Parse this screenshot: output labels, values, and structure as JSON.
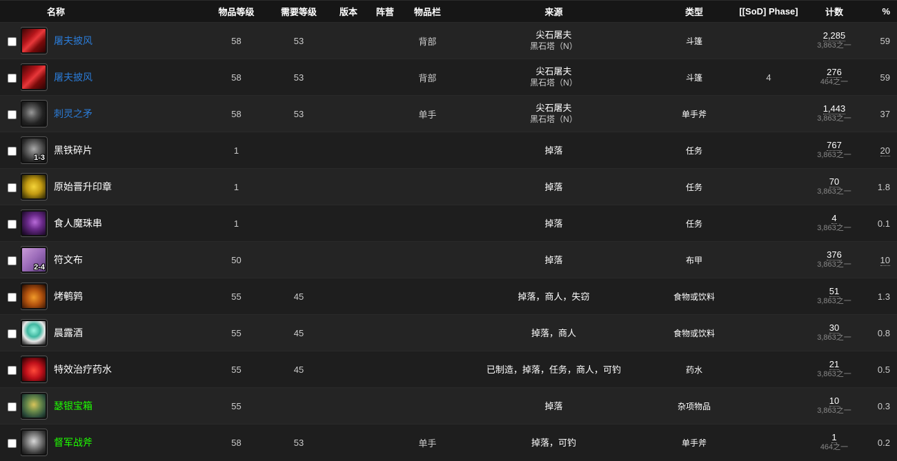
{
  "headers": {
    "name": "名称",
    "item_level": "物品等级",
    "req_level": "需要等级",
    "version": "版本",
    "faction": "阵营",
    "slot": "物品栏",
    "source": "来源",
    "type": "类型",
    "phase": "[[SoD] Phase]",
    "count": "计数",
    "percent": "%"
  },
  "rows": [
    {
      "icon": "cape-icon",
      "icon_class": "ic-cape",
      "qty": "",
      "name": "屠夫披风",
      "quality": "q-blue",
      "ilvl": "58",
      "req": "53",
      "slot": "背部",
      "src1": "尖石屠夫",
      "src2": "黑石塔（N）",
      "type": "斗篷",
      "phase": "",
      "count": "2,285",
      "of": "3,863之一",
      "pct": "59",
      "pct_dotted": false
    },
    {
      "icon": "cape-icon",
      "icon_class": "ic-cape",
      "qty": "",
      "name": "屠夫披风",
      "quality": "q-blue",
      "ilvl": "58",
      "req": "53",
      "slot": "背部",
      "src1": "尖石屠夫",
      "src2": "黑石塔（N）",
      "type": "斗篷",
      "phase": "4",
      "count": "276",
      "of": "464之一",
      "pct": "59",
      "pct_dotted": false
    },
    {
      "icon": "axe-icon",
      "icon_class": "ic-axe",
      "qty": "",
      "name": "刺灵之矛",
      "quality": "q-blue",
      "ilvl": "58",
      "req": "53",
      "slot": "单手",
      "src1": "尖石屠夫",
      "src2": "黑石塔（N）",
      "type": "单手斧",
      "phase": "",
      "count": "1,443",
      "of": "3,863之一",
      "pct": "37",
      "pct_dotted": false
    },
    {
      "icon": "iron-shard-icon",
      "icon_class": "ic-iron",
      "qty": "1-3",
      "name": "黑铁碎片",
      "quality": "q-white",
      "ilvl": "1",
      "req": "",
      "slot": "",
      "src1": "掉落",
      "src2": "",
      "type": "任务",
      "phase": "",
      "count": "767",
      "of": "3,863之一",
      "pct": "20",
      "pct_dotted": true
    },
    {
      "icon": "seal-icon",
      "icon_class": "ic-seal",
      "qty": "",
      "name": "原始晋升印章",
      "quality": "q-white",
      "ilvl": "1",
      "req": "",
      "slot": "",
      "src1": "掉落",
      "src2": "",
      "type": "任务",
      "phase": "",
      "count": "70",
      "of": "3,863之一",
      "pct": "1.8",
      "pct_dotted": false
    },
    {
      "icon": "bead-string-icon",
      "icon_class": "ic-string",
      "qty": "",
      "name": "食人魔珠串",
      "quality": "q-white",
      "ilvl": "1",
      "req": "",
      "slot": "",
      "src1": "掉落",
      "src2": "",
      "type": "任务",
      "phase": "",
      "count": "4",
      "of": "3,863之一",
      "pct": "0.1",
      "pct_dotted": false
    },
    {
      "icon": "cloth-icon",
      "icon_class": "ic-cloth",
      "qty": "2-4",
      "name": "符文布",
      "quality": "q-white",
      "ilvl": "50",
      "req": "",
      "slot": "",
      "src1": "掉落",
      "src2": "",
      "type": "布甲",
      "phase": "",
      "count": "376",
      "of": "3,863之一",
      "pct": "10",
      "pct_dotted": true
    },
    {
      "icon": "roast-bird-icon",
      "icon_class": "ic-bird",
      "qty": "",
      "name": "烤鹌鹑",
      "quality": "q-white",
      "ilvl": "55",
      "req": "45",
      "slot": "",
      "src1": "掉落，商人，失窃",
      "src2": "",
      "type": "食物或饮料",
      "phase": "",
      "count": "51",
      "of": "3,863之一",
      "pct": "1.3",
      "pct_dotted": false
    },
    {
      "icon": "wine-icon",
      "icon_class": "ic-wine",
      "qty": "",
      "name": "晨露酒",
      "quality": "q-white",
      "ilvl": "55",
      "req": "45",
      "slot": "",
      "src1": "掉落，商人",
      "src2": "",
      "type": "食物或饮料",
      "phase": "",
      "count": "30",
      "of": "3,863之一",
      "pct": "0.8",
      "pct_dotted": false
    },
    {
      "icon": "potion-icon",
      "icon_class": "ic-potion",
      "qty": "",
      "name": "特效治疗药水",
      "quality": "q-white",
      "ilvl": "55",
      "req": "45",
      "slot": "",
      "src1": "已制造，掉落，任务，商人，可钓",
      "src2": "",
      "type": "药水",
      "phase": "",
      "count": "21",
      "of": "3,863之一",
      "pct": "0.5",
      "pct_dotted": false
    },
    {
      "icon": "chest-icon",
      "icon_class": "ic-chest",
      "qty": "",
      "name": "瑟银宝箱",
      "quality": "q-green",
      "ilvl": "55",
      "req": "",
      "slot": "",
      "src1": "掉落",
      "src2": "",
      "type": "杂项物品",
      "phase": "",
      "count": "10",
      "of": "3,863之一",
      "pct": "0.3",
      "pct_dotted": false
    },
    {
      "icon": "war-axe-icon",
      "icon_class": "ic-waraxe",
      "qty": "",
      "name": "督军战斧",
      "quality": "q-green",
      "ilvl": "58",
      "req": "53",
      "slot": "单手",
      "src1": "掉落，可钓",
      "src2": "",
      "type": "单手斧",
      "phase": "",
      "count": "1",
      "of": "464之一",
      "pct": "0.2",
      "pct_dotted": false
    }
  ]
}
